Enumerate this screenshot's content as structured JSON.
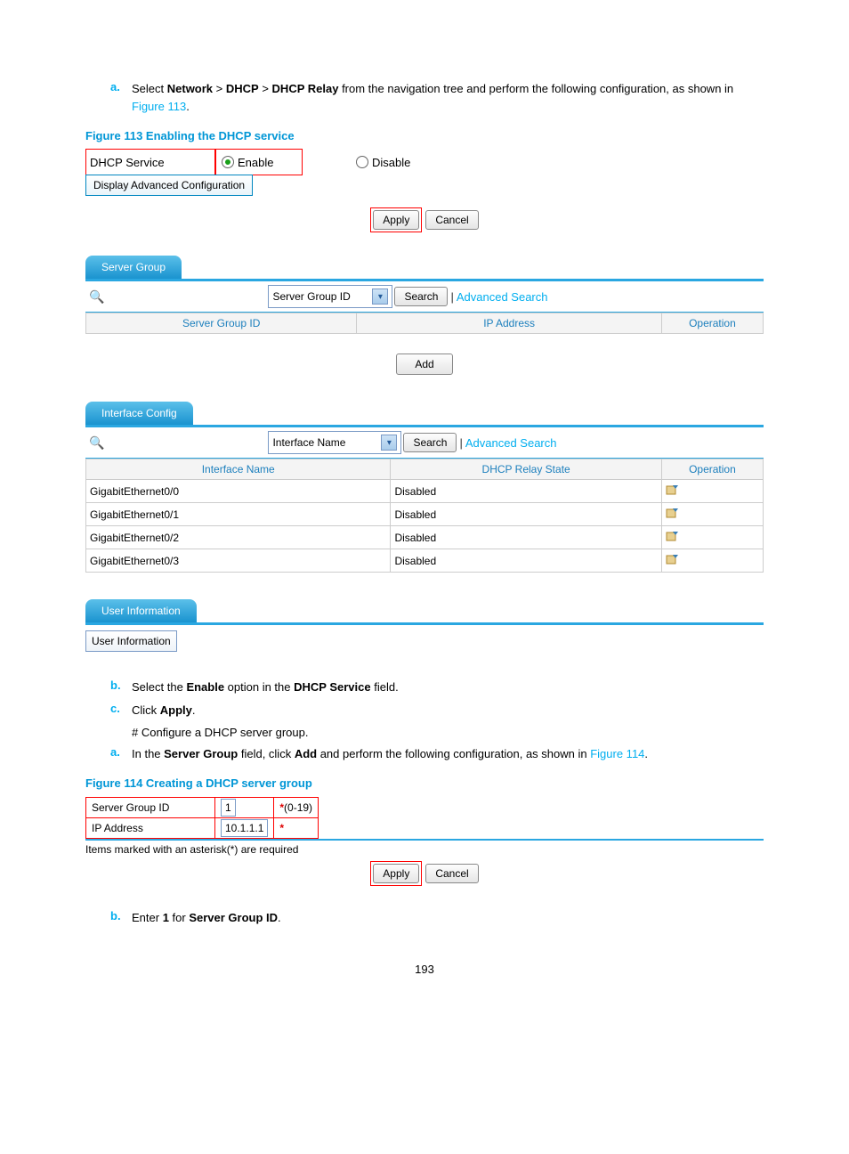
{
  "steps1": {
    "a_text": "Select Network > DHCP > DHCP Relay from the navigation tree and perform the following configuration, as shown in ",
    "a_bold1": "Network",
    "a_bold2": "DHCP",
    "a_bold3": "DHCP Relay",
    "a_link": "Figure 113"
  },
  "fig113_caption": "Figure 113 Enabling the DHCP service",
  "dhcp": {
    "service_label": "DHCP Service",
    "enable": "Enable",
    "disable": "Disable",
    "adv_button": "Display Advanced Configuration",
    "apply": "Apply",
    "cancel": "Cancel"
  },
  "server_group_tab": "Server Group",
  "search": {
    "placeholder": "",
    "field_server_group": "Server Group ID",
    "field_interface": "Interface Name",
    "search_btn": "Search",
    "advanced": "Advanced Search"
  },
  "server_table": {
    "cols": [
      "Server Group ID",
      "IP Address",
      "Operation"
    ],
    "add_btn": "Add"
  },
  "interface_tab": "Interface Config",
  "interface_table": {
    "cols": [
      "Interface Name",
      "DHCP Relay State",
      "Operation"
    ],
    "rows": [
      {
        "name": "GigabitEthernet0/0",
        "state": "Disabled"
      },
      {
        "name": "GigabitEthernet0/1",
        "state": "Disabled"
      },
      {
        "name": "GigabitEthernet0/2",
        "state": "Disabled"
      },
      {
        "name": "GigabitEthernet0/3",
        "state": "Disabled"
      }
    ]
  },
  "user_info_tab": "User Information",
  "user_info_btn": "User Information",
  "steps2": {
    "b": "Select the Enable option in the DHCP Service field.",
    "c": "Click Apply.",
    "note": "# Configure a DHCP server group.",
    "a": "In the Server Group field, click Add and perform the following configuration, as shown in ",
    "a_link": "Figure 114"
  },
  "fig114_caption": "Figure 114 Creating a DHCP server group",
  "form": {
    "server_group_id_label": "Server Group ID",
    "server_group_id_value": "1",
    "server_group_hint": "(0-19)",
    "ip_label": "IP Address",
    "ip_value": "10.1.1.1",
    "required_note": "Items marked with an asterisk(*) are required",
    "apply": "Apply",
    "cancel": "Cancel"
  },
  "steps3": {
    "b": "Enter 1 for Server Group ID."
  },
  "page_number": "193"
}
